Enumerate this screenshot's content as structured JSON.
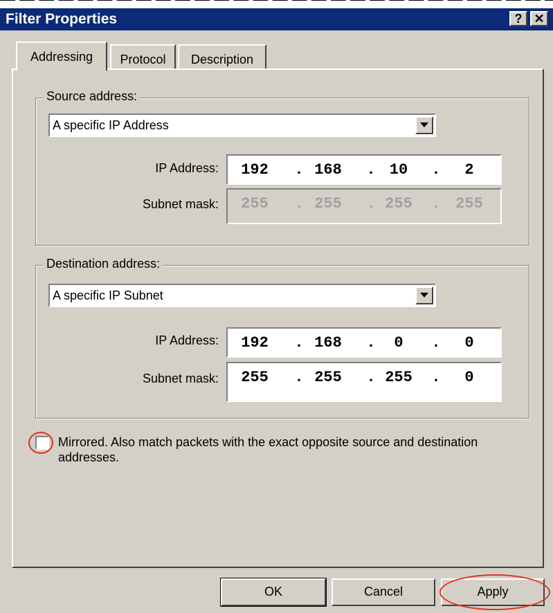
{
  "window": {
    "title": "Filter Properties",
    "help_glyph": "?",
    "close_glyph": "✕"
  },
  "tabs": [
    {
      "label": "Addressing"
    },
    {
      "label": "Protocol"
    },
    {
      "label": "Description"
    }
  ],
  "source": {
    "legend": "Source address:",
    "combo_value": "A specific IP Address",
    "ip_label": "IP Address:",
    "ip": [
      "192",
      "168",
      "10",
      "2"
    ],
    "mask_label": "Subnet mask:",
    "mask": [
      "255",
      "255",
      "255",
      "255"
    ],
    "mask_disabled": true
  },
  "destination": {
    "legend": "Destination address:",
    "combo_value": "A specific IP Subnet",
    "ip_label": "IP Address:",
    "ip": [
      "192",
      "168",
      "0",
      "0"
    ],
    "mask_label": "Subnet mask:",
    "mask": [
      "255",
      "255",
      "255",
      "0"
    ]
  },
  "mirrored": {
    "checked": false,
    "label": "Mirrored. Also match packets with the exact opposite source and destination addresses."
  },
  "buttons": {
    "ok": "OK",
    "cancel": "Cancel",
    "apply": "Apply"
  },
  "colors": {
    "titlebar": "#0b2a78",
    "face": "#d4d0c8",
    "highlight_circle": "#e0321e"
  }
}
